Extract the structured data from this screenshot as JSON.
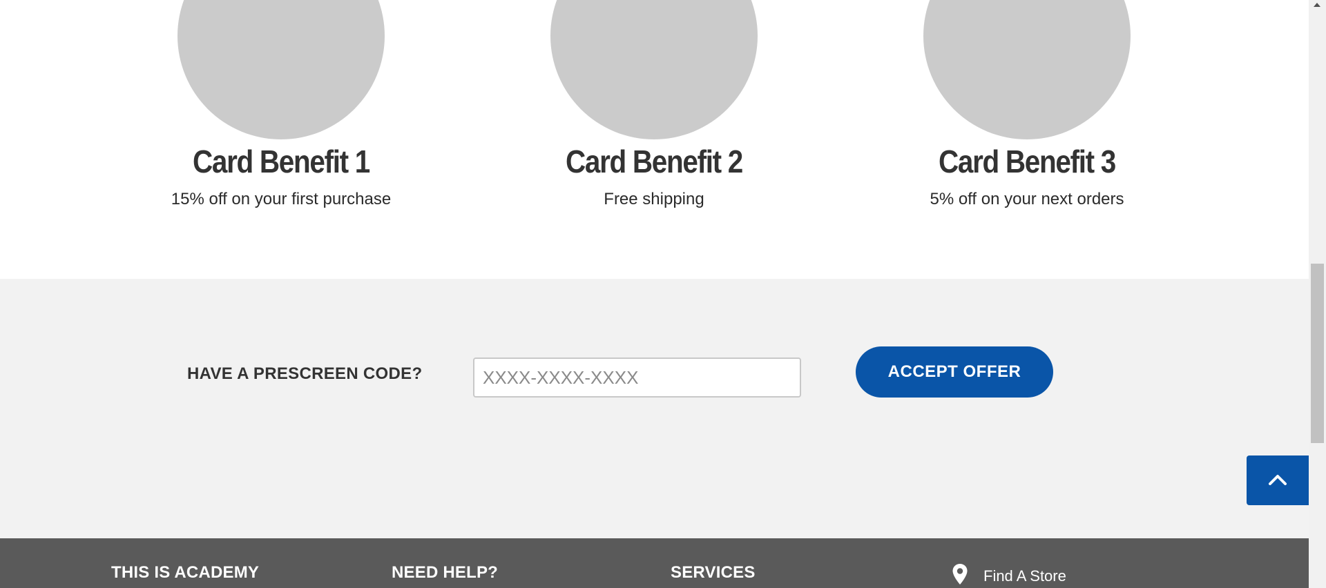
{
  "benefits": [
    {
      "title": "Card Benefit 1",
      "description": "15% off on your first purchase"
    },
    {
      "title": "Card Benefit 2",
      "description": "Free shipping"
    },
    {
      "title": "Card Benefit 3",
      "description": "5% off on your next orders"
    }
  ],
  "prescreen": {
    "label": "HAVE A PRESCREEN CODE?",
    "input_placeholder": "XXXX-XXXX-XXXX",
    "input_value": "",
    "button_label": "ACCEPT OFFER"
  },
  "back_to_top": {
    "icon": "chevron-up-icon"
  },
  "footer": {
    "headings": [
      "THIS IS ACADEMY",
      "NEED HELP?",
      "SERVICES"
    ],
    "store_link": {
      "icon": "map-pin-icon",
      "label": "Find A Store"
    }
  },
  "colors": {
    "accent": "#0a55a8",
    "placeholder_circle": "#cbcbcb",
    "prescreen_bg": "#f2f2f2",
    "footer_bg": "#5a5a5a",
    "text_dark": "#333333"
  }
}
